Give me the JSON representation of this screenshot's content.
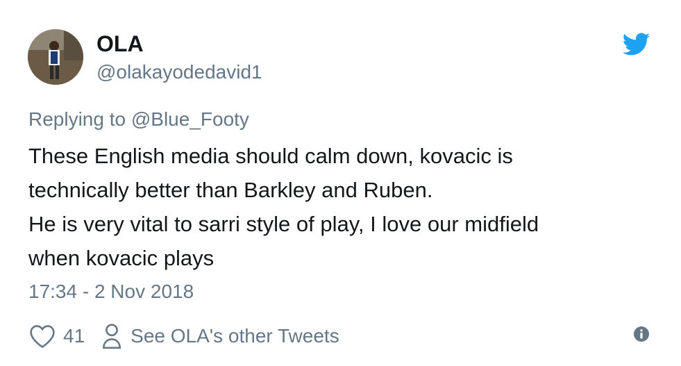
{
  "author": {
    "name": "OLA",
    "handle": "@olakayodedavid1"
  },
  "reply_context": "Replying to @Blue_Footy",
  "tweet_lines": [
    "These English media should calm down, kovacic is",
    "technically better than Barkley and Ruben.",
    "He is very vital to sarri style of play, I love our midfield",
    "when kovacic plays"
  ],
  "timestamp": "17:34 - 2 Nov 2018",
  "actions": {
    "like_count": "41",
    "other_tweets_label": "See OLA's other Tweets"
  },
  "icons": {
    "brand": "twitter-bird-icon",
    "like": "heart-icon",
    "profile": "person-icon",
    "info": "info-icon"
  },
  "colors": {
    "twitter_blue": "#1da1f2",
    "secondary_text": "#657786",
    "primary_text": "#14171a"
  }
}
